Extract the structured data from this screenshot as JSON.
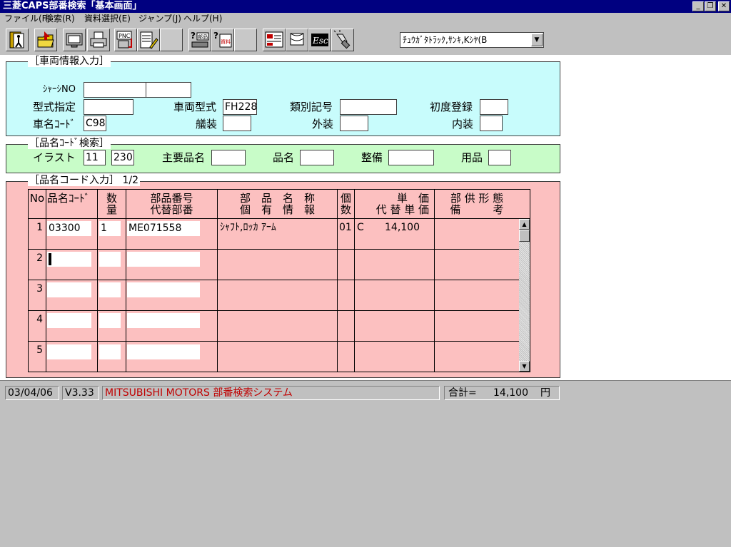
{
  "window": {
    "title": "三菱CAPS部番検索「基本画面」",
    "controls": [
      "_",
      "❐",
      "✕"
    ]
  },
  "menu": [
    "ファイル(F)",
    "検索(R)",
    "資料選択(E)",
    "ジャンプ(J)",
    "ヘルプ(H)"
  ],
  "toolbar": {
    "buttons": [
      "exit-icon",
      "open-folder-icon",
      "monitor-icon",
      "printer-icon",
      "pnc-icon",
      "document-edit-icon",
      "blank",
      "help-catalog-icon",
      "help-material-icon",
      "blank",
      "layout-icon",
      "flag-icon",
      "esc-icon",
      "flashlight-icon"
    ],
    "pnc_label": "PNC",
    "esc_label": "Esc",
    "catalog_label": "部品",
    "material_label": "資料"
  },
  "vehicle_model_select": {
    "value": "ﾁｭｳｶﾞﾀﾄﾗｯｸ,ｻﾝｷ,Kｼﾔ(B"
  },
  "vehicle_info": {
    "legend": "［車両情報入力］",
    "chassis_no_label": "ｼｬｰｼNO",
    "chassis_no_1": "",
    "chassis_no_2": "",
    "model_spec_label": "型式指定",
    "model_spec": "",
    "vehicle_model_label": "車両型式",
    "vehicle_model": "FH228",
    "category_code_label": "類別記号",
    "category_code": "",
    "first_registration_label": "初度登録",
    "first_registration": "",
    "vehicle_code_label": "車名ｺｰﾄﾞ",
    "vehicle_code": "C98",
    "body_label": "艤装",
    "body": "",
    "exterior_label": "外装",
    "exterior": "",
    "interior_label": "内装",
    "interior": ""
  },
  "part_code_search": {
    "legend": "［品名ｺｰﾄﾞ検索］",
    "illust_label": "イラスト",
    "illust_1": "11",
    "illust_2": "230",
    "main_part_label": "主要品名",
    "main_part": "",
    "part_name_label": "品名",
    "part_name": "",
    "maintenance_label": "整備",
    "maintenance": "",
    "supplies_label": "用品",
    "supplies": ""
  },
  "part_code_input": {
    "legend": "［品名コード入力］ 1/2",
    "columns": {
      "no": "No",
      "part_code": "品名ｺｰﾄﾞ",
      "qty_1": "数",
      "qty_2": "量",
      "part_number_1": "部品番号",
      "part_number_2": "代替部番",
      "part_name_1": "部　品　名　称",
      "part_name_2": "個　有　情　報",
      "count_1": "個",
      "count_2": "数",
      "price_1": "単　価",
      "price_2": "代 替 単 価",
      "remarks_1": "部 供 形 態",
      "remarks_2": "備　　　考"
    },
    "rows": [
      {
        "no": "1",
        "part_code": "03300",
        "qty": "1",
        "part_number": "ME071558",
        "part_name": "ｼｬﾌﾄ,ﾛｯｶ ｱｰﾑ",
        "count": "01",
        "price_code": "C",
        "price": "14,100",
        "remarks": ""
      },
      {
        "no": "2",
        "part_code": "",
        "qty": "",
        "part_number": "",
        "part_name": "",
        "count": "",
        "price_code": "",
        "price": "",
        "remarks": ""
      },
      {
        "no": "3",
        "part_code": "",
        "qty": "",
        "part_number": "",
        "part_name": "",
        "count": "",
        "price_code": "",
        "price": "",
        "remarks": ""
      },
      {
        "no": "4",
        "part_code": "",
        "qty": "",
        "part_number": "",
        "part_name": "",
        "count": "",
        "price_code": "",
        "price": "",
        "remarks": ""
      },
      {
        "no": "5",
        "part_code": "",
        "qty": "",
        "part_number": "",
        "part_name": "",
        "count": "",
        "price_code": "",
        "price": "",
        "remarks": ""
      }
    ]
  },
  "status_bar": {
    "date": "03/04/06",
    "version": "V3.33",
    "system_name": "MITSUBISHI MOTORS 部番検索システム",
    "total_label": "合計=",
    "total_value": "14,100",
    "currency": "円"
  },
  "colors": {
    "titlebar": "#000080",
    "vehicle_panel": "#c8fcfc",
    "search_panel": "#c8fcc8",
    "input_panel": "#fcc0c0",
    "system_text": "#c00000"
  }
}
